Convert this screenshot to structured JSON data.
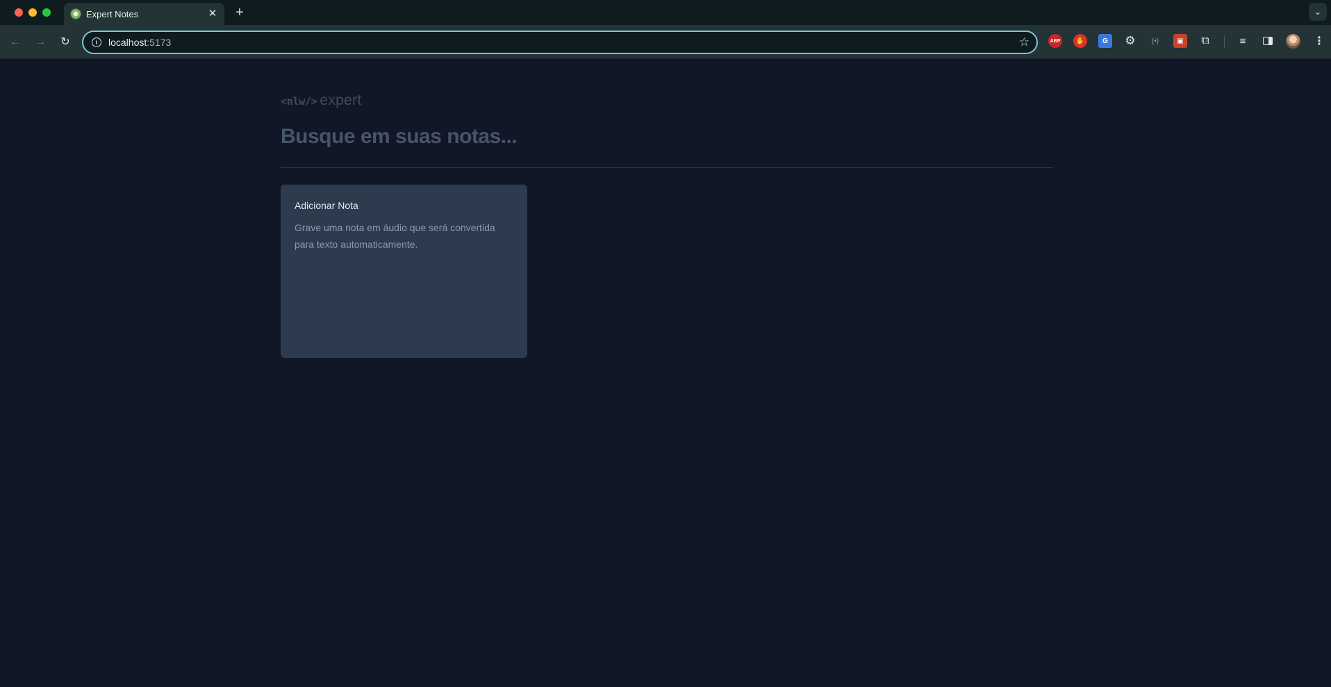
{
  "browser": {
    "tab_title": "Expert Notes",
    "tab_close_glyph": "✕",
    "new_tab_glyph": "+",
    "tab_search_glyph": "⌄",
    "url_host": "localhost",
    "url_port": ":5173",
    "back_glyph": "←",
    "forward_glyph": "→",
    "reload_glyph": "↻",
    "info_glyph": "i",
    "bookmark_glyph": "☆",
    "extensions": {
      "abp_label": "ABP",
      "hand_glyph": "✋",
      "translate_label": "G",
      "gear_glyph": "⚙",
      "radio_glyph": "(•)",
      "photo_glyph": "▣",
      "puzzle_glyph": "⧉",
      "queue_glyph": "≡",
      "menu_glyph": "⋮"
    }
  },
  "page": {
    "logo_nlw": "<nlw/>",
    "logo_expert": "expert",
    "search_placeholder": "Busque em suas notas...",
    "add_note": {
      "title": "Adicionar Nota",
      "description": "Grave uma nota em áudio que será convertida para texto automaticamente."
    }
  },
  "colors": {
    "page_background": "#111726",
    "card_background": "#2e3a4d",
    "omnibox_focus_ring": "#7cc9d4"
  }
}
